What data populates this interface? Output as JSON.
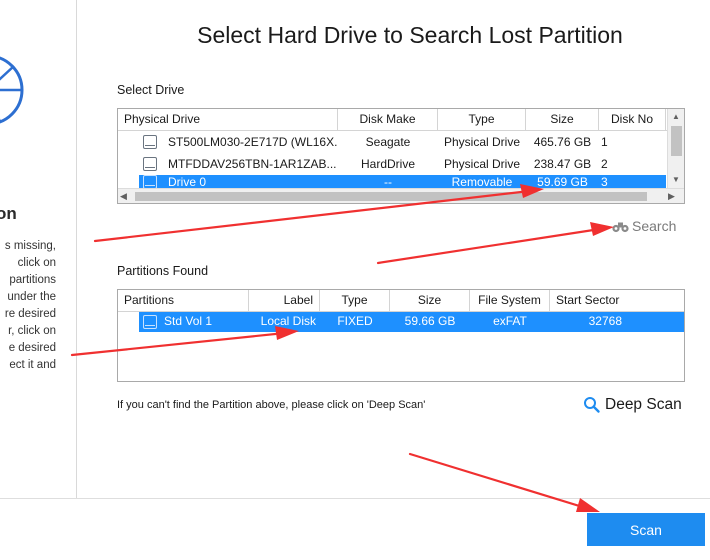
{
  "title": "Select Hard Drive to Search Lost Partition",
  "left_panel": {
    "heading": "on",
    "lines": [
      "s missing,",
      "click on",
      "partitions",
      "under the",
      "re desired",
      "r, click on",
      "e desired",
      "ect it and"
    ]
  },
  "select_drive": {
    "label": "Select Drive",
    "columns": [
      "Physical Drive",
      "Disk Make",
      "Type",
      "Size",
      "Disk No"
    ],
    "rows": [
      {
        "name": "ST500LM030-2E717D (WL16X...",
        "make": "Seagate",
        "type": "Physical Drive",
        "size": "465.76 GB",
        "disk_no": "1"
      },
      {
        "name": "MTFDDAV256TBN-1AR1ZAB...",
        "make": "HardDrive",
        "type": "Physical Drive",
        "size": "238.47 GB",
        "disk_no": "2"
      },
      {
        "name": "Drive 0",
        "make": "--",
        "type": "Removable",
        "size": "59.69 GB",
        "disk_no": "3"
      }
    ],
    "selected_row": 2
  },
  "search": {
    "label": "Search",
    "icon": "binoculars-icon"
  },
  "partitions_found": {
    "label": "Partitions Found",
    "columns": [
      "Partitions",
      "Label",
      "Type",
      "Size",
      "File System",
      "Start Sector"
    ],
    "rows": [
      {
        "name": "Std Vol 1",
        "label": "Local Disk",
        "type": "FIXED",
        "size": "59.66 GB",
        "fs": "exFAT",
        "start": "32768"
      }
    ]
  },
  "hint_text": "If you can't find the Partition above, please click on 'Deep Scan'",
  "deep_scan": {
    "label": "Deep Scan",
    "icon": "magnifier-icon"
  },
  "scan_button": {
    "label": "Scan"
  },
  "colors": {
    "accent": "#1e8cf0",
    "selection": "#1e90ff",
    "annotation_arrow": "#f03030"
  }
}
